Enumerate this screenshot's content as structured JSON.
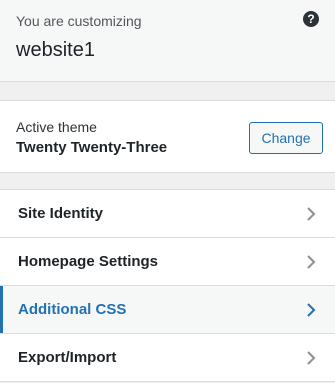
{
  "header": {
    "pre_title": "You are customizing",
    "site_title": "website1",
    "help_icon": "question-circle-icon"
  },
  "theme": {
    "active_label": "Active theme",
    "name": "Twenty Twenty-Three",
    "change_label": "Change"
  },
  "menu": {
    "items": [
      {
        "label": "Site Identity",
        "active": false,
        "icon": "chevron-right-icon"
      },
      {
        "label": "Homepage Settings",
        "active": false,
        "icon": "chevron-right-icon"
      },
      {
        "label": "Additional CSS",
        "active": true,
        "icon": "chevron-right-icon"
      },
      {
        "label": "Export/Import",
        "active": false,
        "icon": "chevron-right-icon"
      }
    ]
  },
  "colors": {
    "accent": "#2271b1",
    "chevron": "#8c8f94",
    "text": "#1d2327"
  }
}
